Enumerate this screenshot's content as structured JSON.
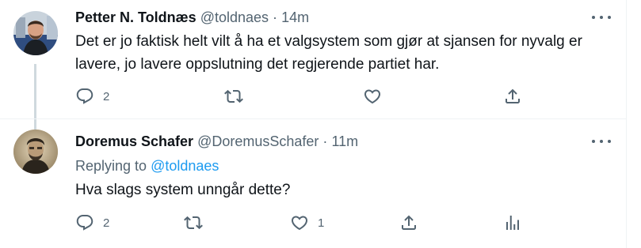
{
  "tweet1": {
    "name": "Petter N. Toldnæs",
    "handle": "@toldnaes",
    "dot": "·",
    "time": "14m",
    "text": "Det er jo faktisk helt vilt å ha et valgsystem som gjør at sjansen for nyvalg er lavere, jo lavere oppslutning det regjerende partiet har.",
    "reply_count": "2",
    "retweet_count": "",
    "like_count": ""
  },
  "tweet2": {
    "name": "Doremus Schafer",
    "handle": "@DoremusSchafer",
    "dot": "·",
    "time": "11m",
    "replying_prefix": "Replying to",
    "replying_to": "@toldnaes",
    "text": "Hva slags system unngår dette?",
    "reply_count": "2",
    "retweet_count": "",
    "like_count": "1"
  },
  "icons": {
    "reply": "reply-icon",
    "retweet": "retweet-icon",
    "like": "heart-icon",
    "share": "share-icon",
    "analytics": "analytics-icon",
    "more": "more-icon"
  },
  "colors": {
    "text": "#0f1419",
    "secondary": "#536471",
    "link": "#1d9bf0",
    "thread_line": "#cfd9de"
  }
}
